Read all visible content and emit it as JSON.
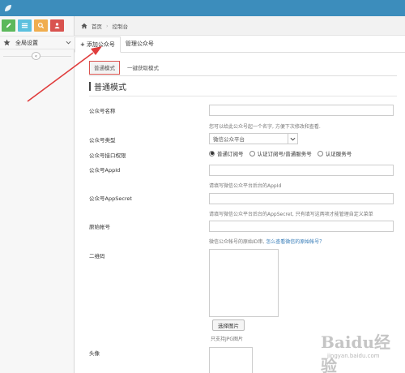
{
  "sidebar": {
    "quick_buttons": [
      {
        "name": "edit",
        "color": "#5cb85c"
      },
      {
        "name": "grid",
        "color": "#5bc0de"
      },
      {
        "name": "search",
        "color": "#f0ad4e"
      },
      {
        "name": "user",
        "color": "#d9534f"
      }
    ],
    "menu_label": "全局设置",
    "collapse_glyph": "«"
  },
  "breadcrumb": {
    "home": "首页",
    "separator": "›",
    "current": "控制台"
  },
  "tabs": [
    {
      "label": "添加公众号",
      "plus": "+"
    },
    {
      "label": "管理公众号"
    }
  ],
  "modes": [
    "普通模式",
    "一键获取模式"
  ],
  "section_title": "普通模式",
  "form": {
    "name_label": "公众号名称",
    "name_help": "您可以给此公众号起一个名字, 方便下次修改和查看.",
    "type_label": "公众号类型",
    "type_value": "微信公众平台",
    "perm_label": "公众号接口权限",
    "perm_options": [
      "普通订阅号",
      "认证订阅号/普通服务号",
      "认证服务号"
    ],
    "appid_label": "公众号AppId",
    "appid_help": "请填写微信公众平台后台的AppId",
    "secret_label": "公众号AppSecret",
    "secret_help": "请填写微信公众平台后台的AppSecret, 只有填写这两项才能管理自定义菜单",
    "orig_label": "原始帐号",
    "orig_help": "微信公众帐号的原始ID串,",
    "orig_link": "怎么查看微信的原始帐号？",
    "qr_label": "二维码",
    "upload_label": "选择图片",
    "upload_help": "只支持JPG图片",
    "avatar_label": "头像"
  },
  "watermark": {
    "text": "Baidu经验",
    "sub": "jingyan.baidu.com"
  },
  "colors": {
    "topbar": "#3c8dbc",
    "annotation_arrow": "#e03c3c",
    "mode_active_border": "#d9534f"
  }
}
